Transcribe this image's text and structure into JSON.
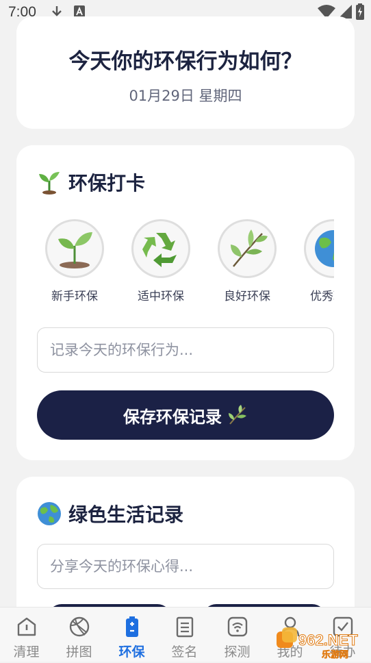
{
  "status_bar": {
    "time": "7:00"
  },
  "header_card": {
    "title": "今天你的环保行为如何？",
    "date": "01月29日 星期四"
  },
  "checkin": {
    "title": "环保打卡",
    "title_icon": "seedling-icon",
    "levels": [
      {
        "label": "新手环保",
        "icon": "sprout-icon"
      },
      {
        "label": "适中环保",
        "icon": "recycle-icon"
      },
      {
        "label": "良好环保",
        "icon": "leaves-icon"
      },
      {
        "label": "优秀环保",
        "icon": "globe-icon"
      }
    ],
    "input_placeholder": "记录今天的环保行为...",
    "save_label": "保存环保记录",
    "save_icon": "herb-icon"
  },
  "green_life": {
    "title": "绿色生活记录",
    "title_icon": "globe-icon",
    "input_placeholder": "分享今天的环保心得..."
  },
  "bottom_nav": {
    "items": [
      {
        "label": "清理",
        "icon": "cleanup-icon"
      },
      {
        "label": "拼图",
        "icon": "puzzle-ball-icon"
      },
      {
        "label": "环保",
        "icon": "battery-icon",
        "active": true
      },
      {
        "label": "签名",
        "icon": "document-icon"
      },
      {
        "label": "探测",
        "icon": "wifi-icon"
      },
      {
        "label": "我的",
        "icon": "user-icon"
      },
      {
        "label": "待办",
        "icon": "checkbox-icon"
      }
    ]
  },
  "watermark": {
    "text": "962.NET",
    "sub": "乐游网"
  },
  "colors": {
    "primary_dark": "#1b2146",
    "active_nav": "#1e6fe0",
    "background": "#f2f2f2"
  }
}
